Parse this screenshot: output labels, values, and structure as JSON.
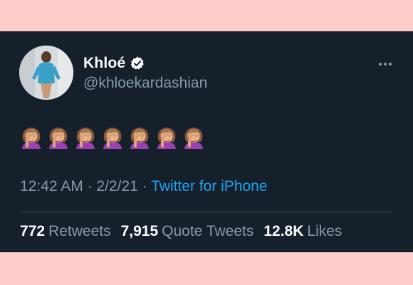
{
  "tweet": {
    "display_name": "Khloé",
    "handle": "@khloekardashian",
    "emoji_count": 7,
    "emoji_name": "woman-facepalming-emoji",
    "time": "12:42 AM",
    "date": "2/2/21",
    "separator": "·",
    "source": "Twitter for iPhone",
    "stats": {
      "retweets_count": "772",
      "retweets_label": "Retweets",
      "quotes_count": "7,915",
      "quotes_label": "Quote Tweets",
      "likes_count": "12.8K",
      "likes_label": "Likes"
    }
  },
  "colors": {
    "page_background": "#ffcccc",
    "card_background": "#15202b",
    "primary_text": "#ffffff",
    "secondary_text": "#8899a6",
    "link": "#1da1f2",
    "divider": "#38444d"
  }
}
